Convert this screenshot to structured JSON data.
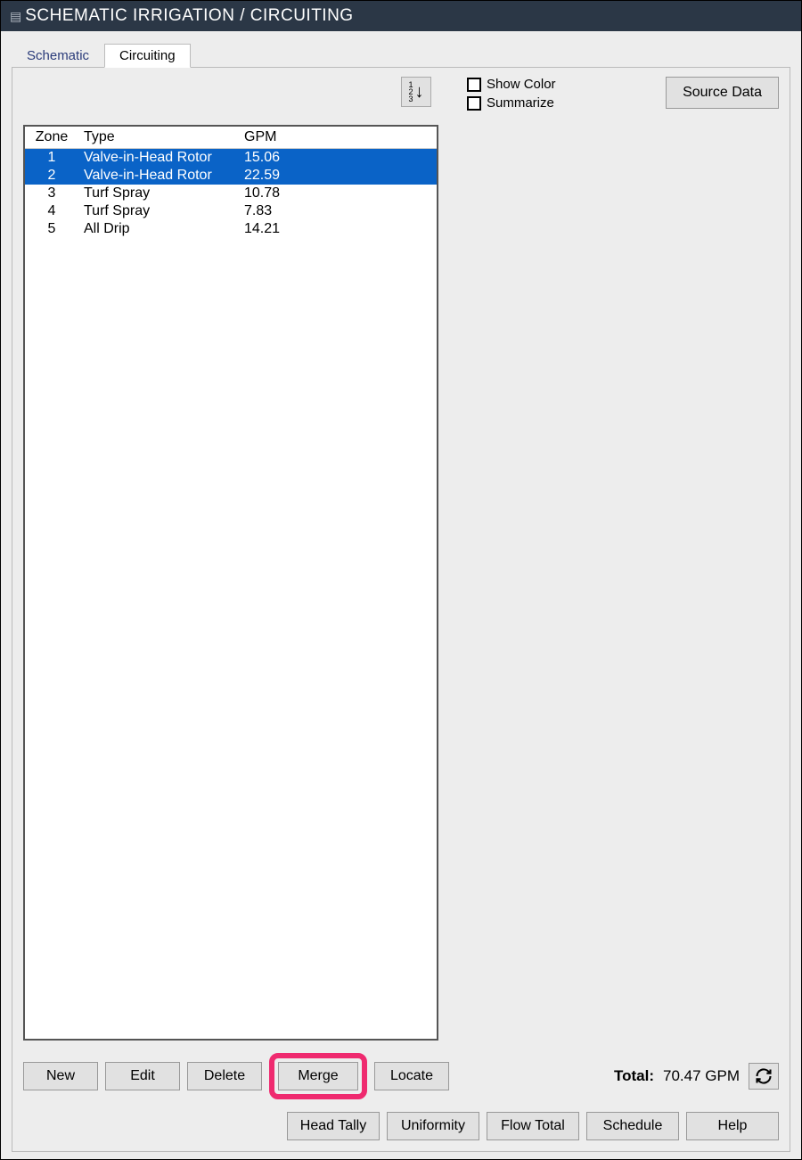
{
  "window": {
    "title": "SCHEMATIC IRRIGATION / CIRCUITING"
  },
  "tabs": {
    "items": [
      {
        "label": "Schematic",
        "active": false
      },
      {
        "label": "Circuiting",
        "active": true
      }
    ]
  },
  "toolbar": {
    "sort_icon": "sort-numeric-icon",
    "show_color_label": "Show Color",
    "summarize_label": "Summarize",
    "source_data_label": "Source Data"
  },
  "grid": {
    "columns": {
      "zone": "Zone",
      "type": "Type",
      "gpm": "GPM"
    },
    "rows": [
      {
        "zone": "1",
        "type": "Valve-in-Head Rotor",
        "gpm": "15.06",
        "selected": true
      },
      {
        "zone": "2",
        "type": "Valve-in-Head Rotor",
        "gpm": "22.59",
        "selected": true
      },
      {
        "zone": "3",
        "type": "Turf Spray",
        "gpm": "10.78",
        "selected": false
      },
      {
        "zone": "4",
        "type": "Turf Spray",
        "gpm": "7.83",
        "selected": false
      },
      {
        "zone": "5",
        "type": "All Drip",
        "gpm": "14.21",
        "selected": false
      }
    ]
  },
  "buttons": {
    "new": "New",
    "edit": "Edit",
    "delete": "Delete",
    "merge": "Merge",
    "locate": "Locate"
  },
  "total": {
    "label": "Total:",
    "value": "70.47 GPM"
  },
  "footer": {
    "head_tally": "Head Tally",
    "uniformity": "Uniformity",
    "flow_total": "Flow Total",
    "schedule": "Schedule",
    "help": "Help"
  },
  "highlight": {
    "target": "merge"
  }
}
